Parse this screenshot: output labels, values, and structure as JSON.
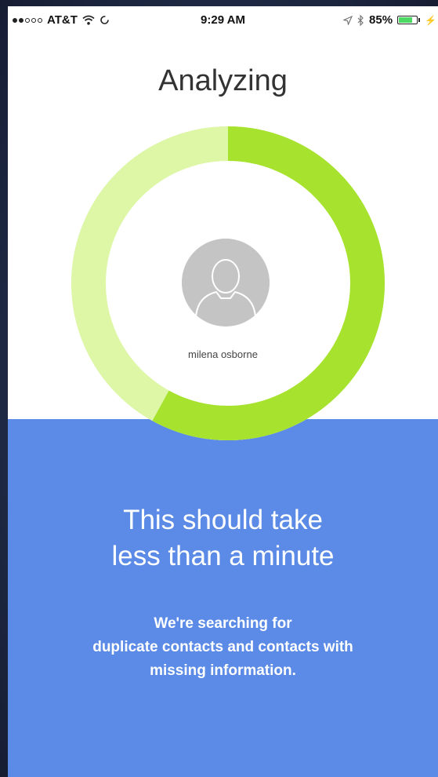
{
  "status_bar": {
    "carrier": "AT&T",
    "time": "9:29 AM",
    "battery_percent": "85%",
    "battery_level": 0.85,
    "icons": [
      "wifi-icon",
      "sync-icon",
      "location-icon",
      "bluetooth-icon",
      "battery-icon",
      "charging-icon"
    ]
  },
  "screen": {
    "title": "Analyzing"
  },
  "progress": {
    "fraction": 0.58,
    "colors": {
      "done": "#a6e22e",
      "remaining": "#ddf7a6",
      "outline": "#bfe38a"
    }
  },
  "contact": {
    "name": "milena osborne",
    "avatar_icon": "person-silhouette-icon"
  },
  "message": {
    "headline_line1": "This should take",
    "headline_line2": "less than a minute",
    "body_line1": "We're searching for",
    "body_line2": "duplicate contacts and contacts with",
    "body_line3": "missing information."
  },
  "colors": {
    "panel": "#5b8be6",
    "text_on_panel": "#ffffff"
  }
}
